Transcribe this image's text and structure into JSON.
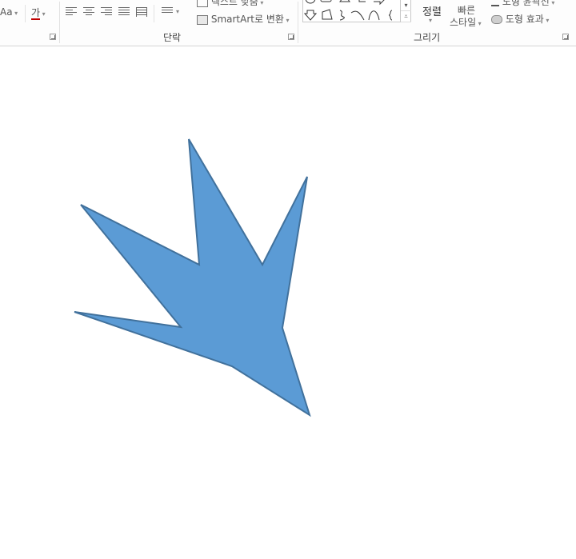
{
  "ribbon": {
    "font": {
      "change_case_label": "Aa",
      "font_color_label": "가"
    },
    "paragraph": {
      "group_label": "단락",
      "align_text_label": "텍스트 맞춤",
      "smartart_label": "SmartArt로 변환"
    },
    "drawing": {
      "group_label": "그리기",
      "arrange_label": "정렬",
      "quick_styles_line1": "빠른",
      "quick_styles_line2": "스타일",
      "shape_outline_label": "도형 윤곽선",
      "shape_effects_label": "도형 효과"
    }
  },
  "slide": {
    "shape": {
      "fill": "#5b9bd5",
      "stroke": "#41719c"
    }
  },
  "colors": {
    "ribbon_bg": "#fdfdfd",
    "separator": "#e1e1e1"
  }
}
